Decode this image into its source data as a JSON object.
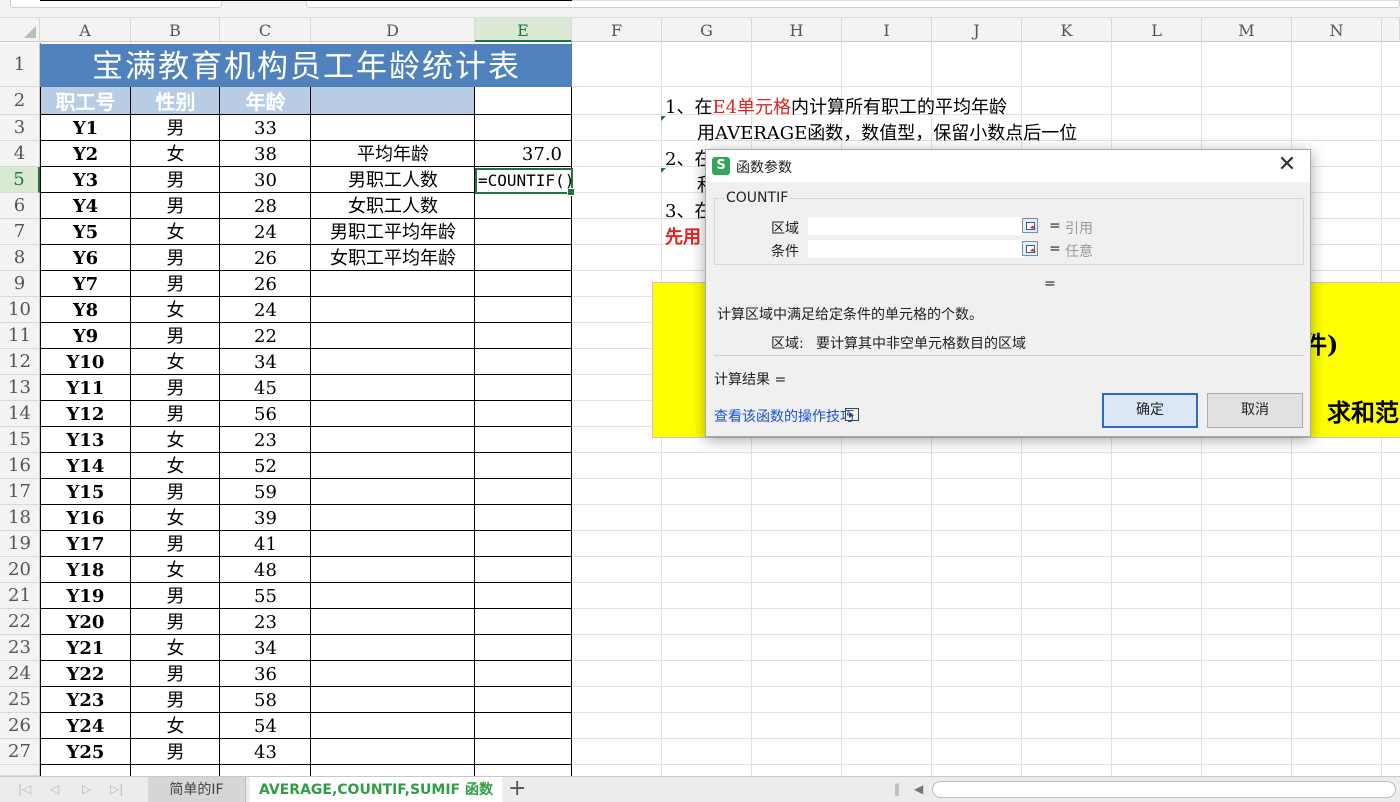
{
  "spreadsheet": {
    "columns": [
      "A",
      "B",
      "C",
      "D",
      "E",
      "F",
      "G",
      "H",
      "I",
      "J",
      "K",
      "L",
      "M",
      "N"
    ],
    "active_column": "E",
    "active_row": "5",
    "rows": [
      "1",
      "2",
      "3",
      "4",
      "5",
      "6",
      "7",
      "8",
      "9",
      "10",
      "11",
      "12",
      "13",
      "14",
      "15",
      "16",
      "17",
      "18",
      "19",
      "20",
      "21",
      "22",
      "23",
      "24",
      "25",
      "26",
      "27"
    ],
    "table_title": "宝满教育机构员工年龄统计表",
    "headers": [
      "职工号",
      "性别",
      "年龄"
    ],
    "employees": [
      {
        "id": "Y1",
        "gender": "男",
        "age": "33"
      },
      {
        "id": "Y2",
        "gender": "女",
        "age": "38"
      },
      {
        "id": "Y3",
        "gender": "男",
        "age": "30"
      },
      {
        "id": "Y4",
        "gender": "男",
        "age": "28"
      },
      {
        "id": "Y5",
        "gender": "女",
        "age": "24"
      },
      {
        "id": "Y6",
        "gender": "男",
        "age": "26"
      },
      {
        "id": "Y7",
        "gender": "男",
        "age": "26"
      },
      {
        "id": "Y8",
        "gender": "女",
        "age": "24"
      },
      {
        "id": "Y9",
        "gender": "男",
        "age": "22"
      },
      {
        "id": "Y10",
        "gender": "女",
        "age": "34"
      },
      {
        "id": "Y11",
        "gender": "男",
        "age": "45"
      },
      {
        "id": "Y12",
        "gender": "男",
        "age": "56"
      },
      {
        "id": "Y13",
        "gender": "女",
        "age": "23"
      },
      {
        "id": "Y14",
        "gender": "女",
        "age": "52"
      },
      {
        "id": "Y15",
        "gender": "男",
        "age": "59"
      },
      {
        "id": "Y16",
        "gender": "女",
        "age": "39"
      },
      {
        "id": "Y17",
        "gender": "男",
        "age": "41"
      },
      {
        "id": "Y18",
        "gender": "女",
        "age": "48"
      },
      {
        "id": "Y19",
        "gender": "男",
        "age": "55"
      },
      {
        "id": "Y20",
        "gender": "男",
        "age": "23"
      },
      {
        "id": "Y21",
        "gender": "女",
        "age": "34"
      },
      {
        "id": "Y22",
        "gender": "男",
        "age": "36"
      },
      {
        "id": "Y23",
        "gender": "男",
        "age": "58"
      },
      {
        "id": "Y24",
        "gender": "女",
        "age": "54"
      },
      {
        "id": "Y25",
        "gender": "男",
        "age": "43"
      }
    ],
    "stats": [
      {
        "label": "平均年龄",
        "value": "37.0"
      },
      {
        "label": "男职工人数",
        "value": "=COUNTIF()"
      },
      {
        "label": "女职工人数",
        "value": ""
      },
      {
        "label": "男职工平均年龄",
        "value": ""
      },
      {
        "label": "女职工平均年龄",
        "value": ""
      }
    ]
  },
  "instructions": {
    "line1_prefix": "1、在",
    "line1_red": "E4单元格",
    "line1_suffix": "内计算所有职工的平均年龄",
    "line2": "用AVERAGE函数，数值型，保留小数点后一位",
    "line3_start": "2、在",
    "line4_start": "和",
    "line5_start": "3、在",
    "line6_red": "先用"
  },
  "yellow_box": {
    "text1": "件)",
    "text2": "求和范"
  },
  "dialog": {
    "title": "函数参数",
    "function_name": "COUNTIF",
    "field1_label": "区域",
    "field1_hint": "引用",
    "field2_label": "条件",
    "field2_hint": "任意",
    "equals": "=",
    "description": "计算区域中满足给定条件的单元格的个数。",
    "param_name": "区域:",
    "param_desc": "要计算其中非空单元格数目的区域",
    "result_label": "计算结果 =",
    "help_link": "查看该函数的操作技巧",
    "ok_label": "确定",
    "cancel_label": "取消"
  },
  "sheet_tabs": {
    "tab1": "简单的IF",
    "tab2": "AVERAGE,COUNTIF,SUMIF 函数",
    "add": "+"
  },
  "colors": {
    "accent_green": "#217346",
    "title_blue": "#4f81bd",
    "header_blue": "#b8cce4",
    "highlight_yellow": "#ffff00",
    "instruction_red": "#e0231f"
  }
}
